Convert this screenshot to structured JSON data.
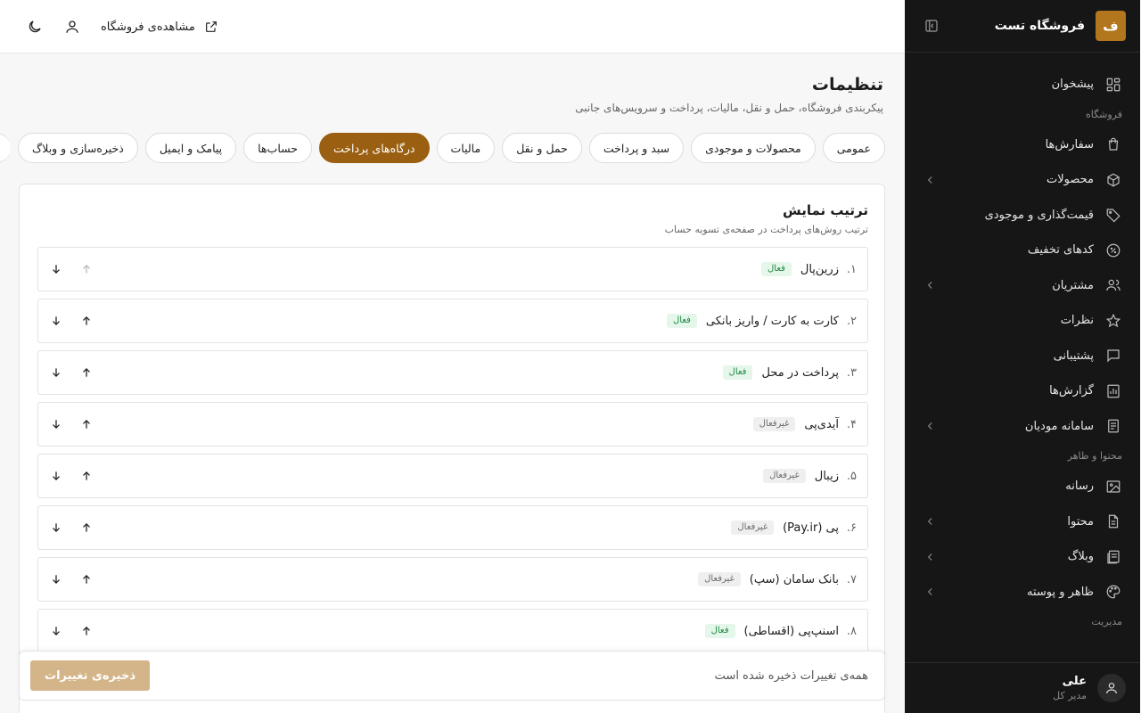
{
  "brand": {
    "logo_letter": "ف",
    "name": "فروشگاه تست"
  },
  "sidebar": {
    "dashboard": "پیشخوان",
    "group_store": "فروشگاه",
    "store_items": [
      {
        "label": "سفارش‌ها",
        "icon": "bag-icon",
        "has_children": false
      },
      {
        "label": "محصولات",
        "icon": "box-icon",
        "has_children": true
      },
      {
        "label": "قیمت‌گذاری و موجودی",
        "icon": "tag-icon",
        "has_children": false
      },
      {
        "label": "کدهای تخفیف",
        "icon": "discount-icon",
        "has_children": false
      },
      {
        "label": "مشتریان",
        "icon": "users-icon",
        "has_children": true
      },
      {
        "label": "نظرات",
        "icon": "star-icon",
        "has_children": false
      },
      {
        "label": "پشتیبانی",
        "icon": "chat-icon",
        "has_children": false
      },
      {
        "label": "گزارش‌ها",
        "icon": "report-icon",
        "has_children": false
      },
      {
        "label": "سامانه مودیان",
        "icon": "document-icon",
        "has_children": true
      }
    ],
    "group_content": "محتوا و ظاهر",
    "content_items": [
      {
        "label": "رسانه",
        "icon": "image-icon",
        "has_children": false
      },
      {
        "label": "محتوا",
        "icon": "file-icon",
        "has_children": true
      },
      {
        "label": "وبلاگ",
        "icon": "blog-icon",
        "has_children": true
      },
      {
        "label": "ظاهر و پوسته",
        "icon": "palette-icon",
        "has_children": true
      }
    ],
    "group_admin": "مدیریت"
  },
  "user": {
    "name": "علی",
    "role": "مدیر کل"
  },
  "topbar": {
    "view_store": "مشاهده‌ی فروشگاه"
  },
  "page": {
    "title": "تنظیمات",
    "subtitle": "پیکربندی فروشگاه، حمل و نقل، مالیات، پرداخت و سرویس‌های جانبی"
  },
  "tabs": [
    {
      "label": "عمومی",
      "active": false
    },
    {
      "label": "محصولات و موجودی",
      "active": false
    },
    {
      "label": "سبد و پرداخت",
      "active": false
    },
    {
      "label": "حمل و نقل",
      "active": false
    },
    {
      "label": "مالیات",
      "active": false
    },
    {
      "label": "درگاه‌های پرداخت",
      "active": true
    },
    {
      "label": "حساب‌ها",
      "active": false
    },
    {
      "label": "پیامک و ایمیل",
      "active": false
    },
    {
      "label": "ذخیره‌سازی و وبلاگ",
      "active": false
    }
  ],
  "card": {
    "title": "ترتیب نمایش",
    "subtitle": "ترتیب روش‌های پرداخت در صفحه‌ی تسویه حساب"
  },
  "gateways": [
    {
      "index": "۱.",
      "name": "زرین‌پال",
      "status": "فعال",
      "active": true,
      "can_up": false,
      "can_down": true
    },
    {
      "index": "۲.",
      "name": "کارت به کارت / واریز بانکی",
      "status": "فعال",
      "active": true,
      "can_up": true,
      "can_down": true
    },
    {
      "index": "۳.",
      "name": "پرداخت در محل",
      "status": "فعال",
      "active": true,
      "can_up": true,
      "can_down": true
    },
    {
      "index": "۴.",
      "name": "آیدی‌پی",
      "status": "غیرفعال",
      "active": false,
      "can_up": true,
      "can_down": true
    },
    {
      "index": "۵.",
      "name": "زیبال",
      "status": "غیرفعال",
      "active": false,
      "can_up": true,
      "can_down": true
    },
    {
      "index": "۶.",
      "name": "پی (Pay.ir)",
      "status": "غیرفعال",
      "active": false,
      "can_up": true,
      "can_down": true
    },
    {
      "index": "۷.",
      "name": "بانک سامان (سپ)",
      "status": "غیرفعال",
      "active": false,
      "can_up": true,
      "can_down": true
    },
    {
      "index": "۸.",
      "name": "اسنپ‌پی (اقساطی)",
      "status": "فعال",
      "active": true,
      "can_up": true,
      "can_down": true
    }
  ],
  "savebar": {
    "status": "همه‌ی تغییرات ذخیره شده است",
    "button": "ذخیره‌ی تغییرات"
  },
  "colors": {
    "accent": "#9a5f10",
    "sidebar_bg": "#161616",
    "logo_bg": "#b2761c",
    "save_btn": "#d4b589",
    "badge_on": "#1d8a44"
  }
}
